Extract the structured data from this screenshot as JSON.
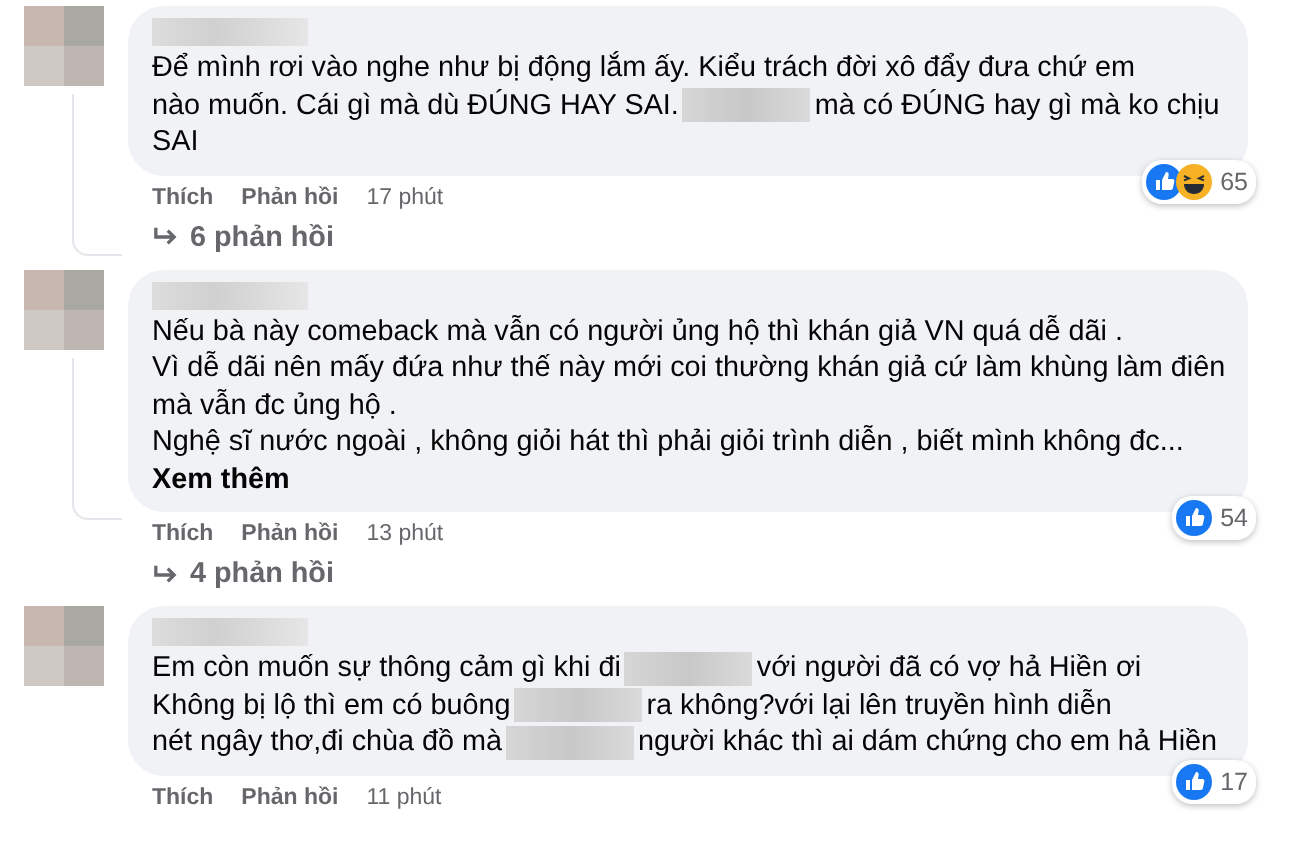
{
  "comments": [
    {
      "lines": [
        [
          {
            "kind": "text",
            "text": "Để mình rơi vào nghe như bị động lắm ấy. Kiểu trách đời xô đẩy đưa chứ em"
          }
        ],
        [
          {
            "kind": "text",
            "text": "nào muốn. Cái gì mà dù ĐÚNG HAY SAI."
          },
          {
            "kind": "blur"
          },
          {
            "kind": "text",
            "text": "mà có ĐÚNG hay gì mà ko chịu"
          }
        ],
        [
          {
            "kind": "text",
            "text": "SAI"
          }
        ]
      ],
      "reactions": [
        {
          "kind": "like"
        },
        {
          "kind": "haha"
        }
      ],
      "reaction_count": "65",
      "like": "Thích",
      "reply": "Phản hồi",
      "time": "17 phút",
      "replies": "6 phản hồi"
    },
    {
      "lines": [
        [
          {
            "kind": "text",
            "text": "Nếu bà này comeback mà vẫn có người ủng hộ thì khán giả VN quá dễ dãi ."
          }
        ],
        [
          {
            "kind": "text",
            "text": "Vì dễ dãi nên mấy đứa như thế này mới coi thường khán giả cứ làm khùng làm điên"
          }
        ],
        [
          {
            "kind": "text",
            "text": "mà vẫn đc ủng hộ ."
          }
        ],
        [
          {
            "kind": "text",
            "text": "Nghệ sĩ nước ngoài , không giỏi hát thì phải giỏi trình diễn , biết mình không đc..."
          }
        ]
      ],
      "see_more": "Xem thêm",
      "reactions": [
        {
          "kind": "like"
        }
      ],
      "reaction_count": "54",
      "like": "Thích",
      "reply": "Phản hồi",
      "time": "13 phút",
      "replies": "4 phản hồi"
    },
    {
      "lines": [
        [
          {
            "kind": "text",
            "text": "Em còn muốn sự thông cảm gì khi đi"
          },
          {
            "kind": "blur"
          },
          {
            "kind": "text",
            "text": "với người đã có vợ hả Hiền ơi"
          }
        ],
        [
          {
            "kind": "text",
            "text": "Không bị lộ thì em có buông"
          },
          {
            "kind": "blur"
          },
          {
            "kind": "text",
            "text": "ra không?với lại lên truyền hình diễn"
          }
        ],
        [
          {
            "kind": "text",
            "text": "nét ngây thơ,đi chùa đồ mà"
          },
          {
            "kind": "blur"
          },
          {
            "kind": "text",
            "text": "người khác thì ai dám chứng cho em hả Hiền"
          }
        ]
      ],
      "reactions": [
        {
          "kind": "like"
        }
      ],
      "reaction_count": "17",
      "like": "Thích",
      "reply": "Phản hồi",
      "time": "11 phút"
    }
  ]
}
